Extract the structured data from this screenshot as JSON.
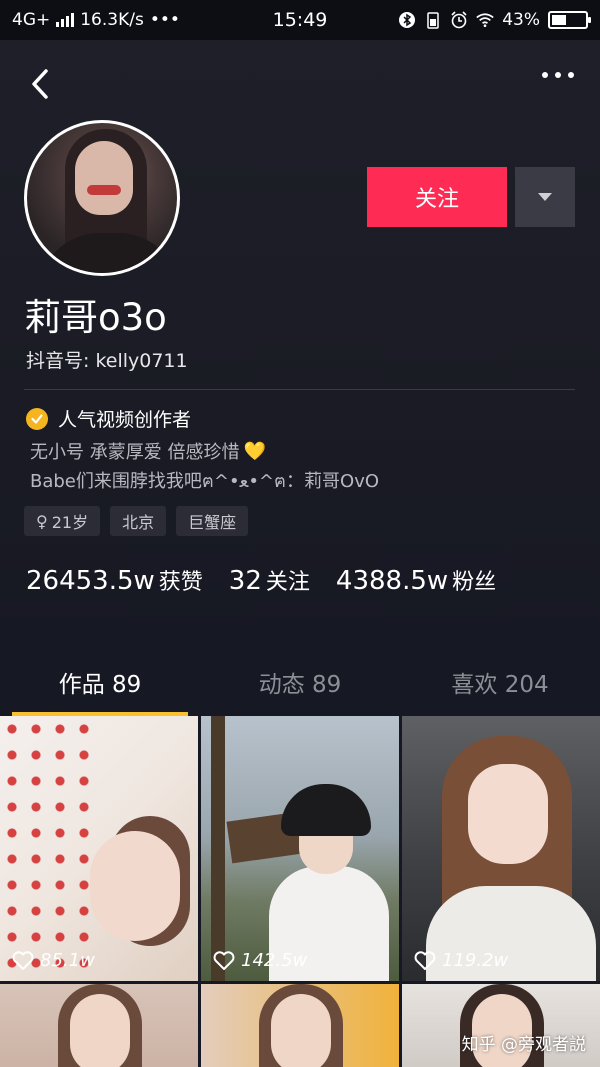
{
  "status_bar": {
    "network": "4G+",
    "speed": "16.3K/s",
    "more": "•••",
    "time": "15:49",
    "battery": "43%",
    "battery_level": 0.43
  },
  "profile": {
    "follow_label": "关注",
    "nickname": "莉哥o3o",
    "douyin_id": "抖音号: kelly0711",
    "verification": "人气视频创作者",
    "bio_line1": "无小号 承蒙厚爱 倍感珍惜",
    "bio_heart": "💛",
    "bio_line2": "Babe们来围脖找我吧ฅ^•ﻌ•^ฅ：莉哥OvO",
    "tags": {
      "age_icon": "♀",
      "age": "21岁",
      "city": "北京",
      "zodiac": "巨蟹座"
    },
    "stats": {
      "likes_num": "26453.5w",
      "likes_label": "获赞",
      "following_num": "32",
      "following_label": "关注",
      "followers_num": "4388.5w",
      "followers_label": "粉丝"
    }
  },
  "tabs": {
    "works": "作品 89",
    "moments": "动态 89",
    "liked": "喜欢 204"
  },
  "videos": [
    {
      "likes": "85.1w"
    },
    {
      "likes": "142.5w"
    },
    {
      "likes": "119.2w"
    }
  ],
  "watermark": "知乎 @旁观者説",
  "icons": {
    "back": "back-arrow-icon",
    "more": "more-dots-icon",
    "verified": "verified-check-icon",
    "dropdown": "caret-down-icon",
    "heart": "heart-outline-icon"
  },
  "colors": {
    "background": "#161823",
    "follow_button": "#fe2c55",
    "tab_indicator": "#fbc02d",
    "verified_badge": "#f4b521"
  }
}
